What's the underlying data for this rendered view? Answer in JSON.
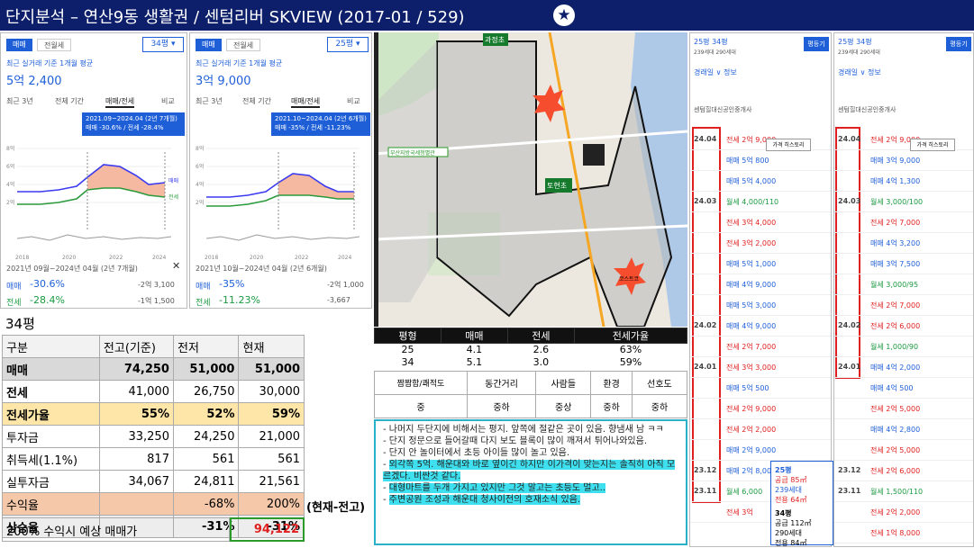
{
  "header": {
    "title": "단지분석 –  연산9동 생활권 /  센텀리버 SKVIEW      (2017-01 / 529)",
    "star": "★"
  },
  "panels": [
    {
      "tab1": "매매",
      "tab2": "전월세",
      "select": "34평 ▾",
      "sub": "최근 실거래 기준 1개월 평균",
      "price": "5억 2,400",
      "tabs": [
        "최근 3년",
        "전체 기간",
        "매매/전세",
        "비교"
      ],
      "tip1": "2021.09~2024.04 (2년 7개월)",
      "tip2": "매매 -30.6% / 전세 -28.4%",
      "years": [
        "2018",
        "2020",
        "2022",
        "2024"
      ],
      "range": "2021년 09월~2024년 04월 (2년 7개월)",
      "r1l": "매매",
      "r1v": "-30.6%",
      "r1a": "-2억 3,100",
      "r2l": "전세",
      "r2v": "-28.4%",
      "r2a": "-1억 1,500"
    },
    {
      "tab1": "매매",
      "tab2": "전월세",
      "select": "25평 ▾",
      "sub": "최근 실거래 기준 1개월 평균",
      "price": "3억 9,000",
      "tabs": [
        "최근 3년",
        "전체 기간",
        "매매/전세",
        "비교"
      ],
      "tip1": "2021.10~2024.04 (2년 6개월)",
      "tip2": "매매 -35% / 전세 -11.23%",
      "years": [
        "2018",
        "2020",
        "2022",
        "2024"
      ],
      "range": "2021년 10월~2024년 04월 (2년 6개월)",
      "r1l": "매매",
      "r1v": "-35%",
      "r1a": "-2억 1,000",
      "r2l": "전세",
      "r2v": "-11.23%",
      "r2a": "-3,667"
    }
  ],
  "map": {
    "labels": [
      "과정초",
      "토현초",
      "부산지방국세청별관",
      "코스트코"
    ]
  },
  "analysis": {
    "title": "34평",
    "headers": [
      "구분",
      "전고(기준)",
      "전저",
      "현재"
    ],
    "rows": [
      [
        "매매",
        "74,250",
        "51,000",
        "51,000"
      ],
      [
        "전세",
        "41,000",
        "26,750",
        "30,000"
      ],
      [
        "전세가율",
        "55%",
        "52%",
        "59%"
      ],
      [
        "투자금",
        "33,250",
        "24,250",
        "21,000"
      ],
      [
        "취득세(1.1%)",
        "817",
        "561",
        "561"
      ],
      [
        "실투자금",
        "34,067",
        "24,811",
        "21,561"
      ],
      [
        "수익율",
        "",
        "-68%",
        "200%"
      ],
      [
        "상승율",
        "",
        "-31%",
        "-31%"
      ]
    ],
    "note": "(현재-전고)",
    "forecast_label": "200% 수익시 예상 매매가",
    "forecast_value": "94,122"
  },
  "pyeong": {
    "headers": [
      "평형",
      "매매",
      "전세",
      "전세가율"
    ],
    "rows": [
      [
        "25",
        "4.1",
        "2.6",
        "63%"
      ],
      [
        "34",
        "5.1",
        "3.0",
        "59%"
      ]
    ]
  },
  "rating": {
    "headers": [
      "짬짬함/쾌적도",
      "동간거리",
      "사람들",
      "환경",
      "선호도"
    ],
    "values": [
      "중",
      "중하",
      "중상",
      "중하",
      "중하"
    ]
  },
  "memo": [
    "나머지 두단지에 비해서는 평지. 앞쪽에 절같은 곳이 있음. 향냄새 남 ㅋㅋ",
    "단지 정문으로 들어갈때 다지 보도 블록이 많이 깨져서 튀어나와있음.",
    "단지 안 놀이터에서 초등 아이들 많이 놀고 있음.",
    "외각쪽 5억. 해운대와 바로 옆이긴 하지만 이가격이 맞는지는 솔직히 아직 모르겠다. 비싼것 같다.",
    "대형마트를 두개 가지고 있지만 그것 말고는 초등도 멀고..",
    "주변공원 조성과 해운대 청사이전의 호재소식 있음."
  ],
  "list1": {
    "head": "25평  34평",
    "sub": "239세대  290세대",
    "btn": "평등기",
    "tools": "경래일 ∨  정보",
    "hist": "가격 히스토리",
    "agent": "센텀힐대신공인중개사",
    "dates": [
      "24.04",
      "",
      "",
      "24.03",
      "",
      "",
      "",
      "",
      "",
      "24.02",
      "",
      "24.01",
      "",
      "",
      "",
      "",
      "23.12",
      "23.11"
    ],
    "items": [
      "전세 2억 9,000",
      "매매 5억 800",
      "매매 5억 4,000",
      "월세 4,000/110",
      "전세 3억 4,000",
      "전세 3억 2,000",
      "매매 5억 1,000",
      "매매 4억 9,000",
      "매매 5억 3,000",
      "매매 4억 9,000",
      "전세 2억 7,000",
      "전세 3억 3,000",
      "매매 5억 500",
      "전세 2억 9,000",
      "전세 2억 2,000",
      "매매 2억 9,000",
      "매매 2억 8,000",
      "월세 6,000",
      "전세 3억"
    ]
  },
  "list2": {
    "items": [
      "전세 2억 9,000",
      "매매 3억 9,000",
      "매매 4억 1,300",
      "월세 3,000/100",
      "전세 2억 7,000",
      "매매 4억 3,200",
      "매매 3억 7,500",
      "월세 3,000/95",
      "전세 2억 7,000",
      "전세 2억 6,000",
      "월세 1,000/90",
      "매매 4억 2,000",
      "매매 4억 500",
      "전세 2억 5,000",
      "매매 4억 2,800",
      "전세 2억 5,000",
      "전세 2억 6,000",
      "월세 1,500/110",
      "전세 2억 2,000",
      "전세 1억 8,000"
    ]
  },
  "popup": {
    "l1": "25평",
    "l1b": "공급 85㎡",
    "l2": "239세대",
    "l2b": "전용 64㎡",
    "l3": "34평",
    "l3b": "공급 112㎡",
    "l4": "290세대",
    "l4b": "전용 84㎡"
  },
  "colors": {
    "navy": "#0d1f6b",
    "blue": "#1e5fd8",
    "green": "#1a9a40",
    "red": "#e02020"
  }
}
